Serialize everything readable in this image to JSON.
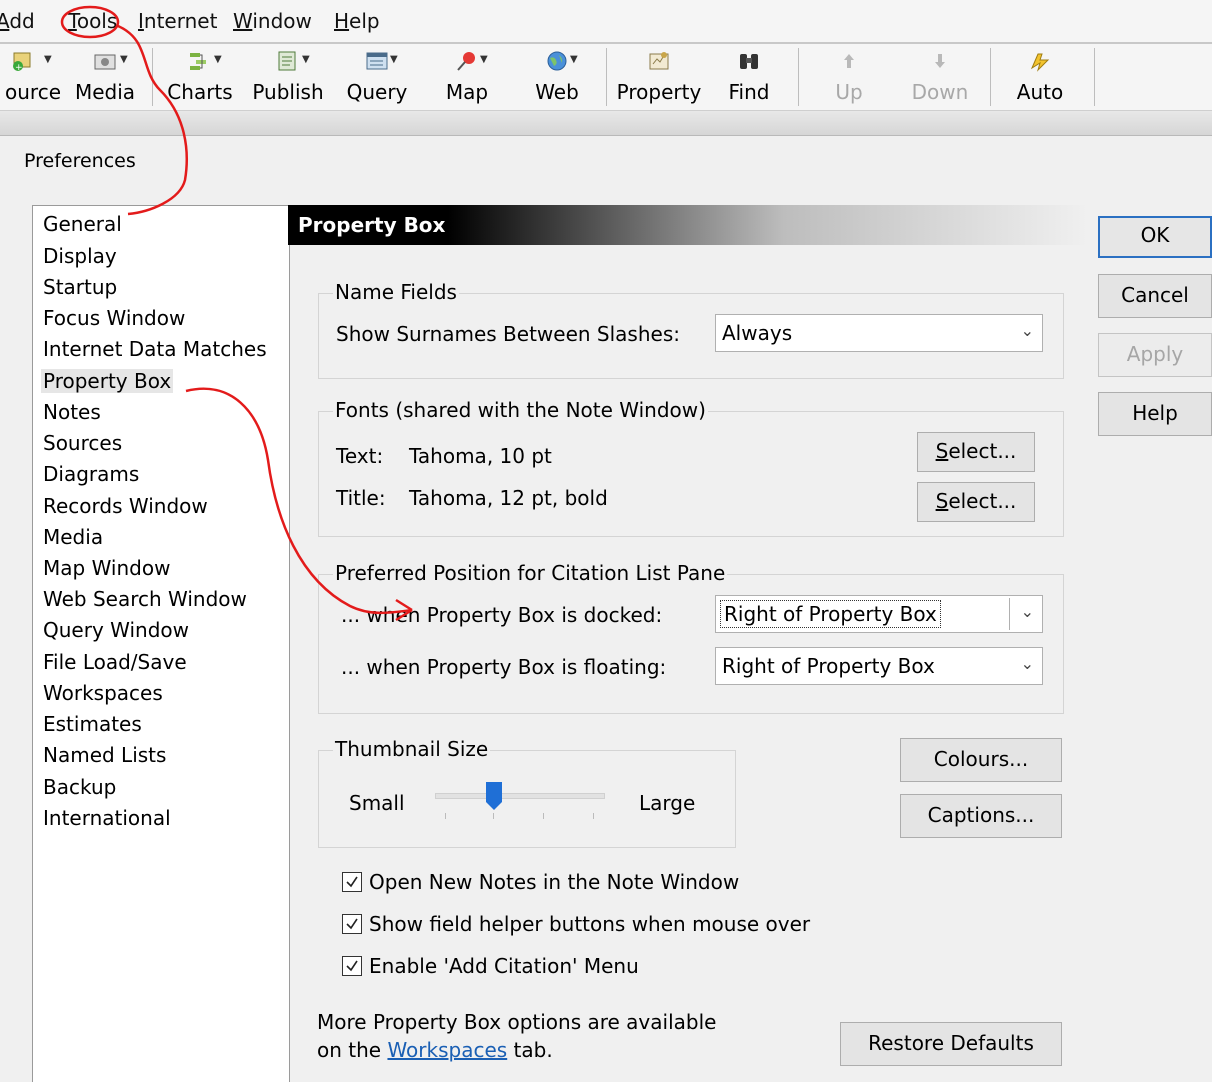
{
  "menubar": {
    "items": [
      {
        "label": "Add",
        "underline": "A",
        "rest": "dd"
      },
      {
        "label": "Tools",
        "underline": "T",
        "rest": "ools"
      },
      {
        "label": "Internet",
        "underline": "I",
        "rest": "nternet"
      },
      {
        "label": "Window",
        "underline": "W",
        "rest": "indow"
      },
      {
        "label": "Help",
        "underline": "H",
        "rest": "elp"
      }
    ]
  },
  "toolbar": {
    "buttons": [
      {
        "label": "ource",
        "icon": "source-icon"
      },
      {
        "label": "Media",
        "icon": "media-icon"
      },
      {
        "label": "Charts",
        "icon": "charts-icon"
      },
      {
        "label": "Publish",
        "icon": "publish-icon"
      },
      {
        "label": "Query",
        "icon": "query-icon"
      },
      {
        "label": "Map",
        "icon": "map-pin-icon"
      },
      {
        "label": "Web",
        "icon": "globe-icon"
      },
      {
        "label": "Property",
        "icon": "property-icon"
      },
      {
        "label": "Find",
        "icon": "binoculars-icon"
      },
      {
        "label": "Up",
        "icon": "up-arrow-icon",
        "disabled": true
      },
      {
        "label": "Down",
        "icon": "down-arrow-icon",
        "disabled": true
      },
      {
        "label": "Auto",
        "icon": "auto-icon"
      }
    ]
  },
  "dialog": {
    "title": "Preferences",
    "nav": {
      "items": [
        "General",
        "Display",
        "Startup",
        "Focus Window",
        "Internet Data Matches",
        "Property Box",
        "Notes",
        "Sources",
        "Diagrams",
        "Records Window",
        "Media",
        "Map Window",
        "Web Search Window",
        "Query Window",
        "File Load/Save",
        "Workspaces",
        "Estimates",
        "Named Lists",
        "Backup",
        "International"
      ],
      "selected": "Property Box"
    },
    "panel": {
      "header": "Property Box",
      "name_fields": {
        "legend": "Name Fields",
        "surnames_label": "Show Surnames Between Slashes:",
        "surnames_value": "Always"
      },
      "fonts": {
        "legend": "Fonts (shared with the Note Window)",
        "text_label": "Text:",
        "text_value": "Tahoma, 10 pt",
        "title_label": "Title:",
        "title_value": "Tahoma, 12 pt, bold",
        "select_label": "Select...",
        "select_underline": "S",
        "select_rest": "elect..."
      },
      "citation": {
        "legend": "Preferred Position for Citation List Pane",
        "docked_label": "... when Property Box is docked:",
        "docked_value": "Right of Property Box",
        "floating_label": "... when Property Box is floating:",
        "floating_value": "Right of Property Box"
      },
      "thumbnail": {
        "legend": "Thumbnail Size",
        "small_label": "Small",
        "large_label": "Large",
        "slider_position": 0.35
      },
      "colours_label": "Colours...",
      "captions_label": "Captions...",
      "checkboxes": [
        {
          "label": "Open New Notes in the Note Window",
          "checked": true
        },
        {
          "label": "Show field helper buttons when mouse over",
          "checked": true
        },
        {
          "label": "Enable 'Add Citation' Menu",
          "checked": true
        }
      ],
      "footer_text_1": "More Property Box options are available",
      "footer_text_2_pre": "on the ",
      "footer_link": "Workspaces",
      "footer_text_2_post": " tab.",
      "restore_label": "Restore Defaults"
    },
    "buttons": {
      "ok": "OK",
      "cancel": "Cancel",
      "apply": "Apply",
      "help": "Help"
    }
  },
  "colors": {
    "annotation_red": "#e31b1b",
    "link_blue": "#1a5fb4",
    "default_button_border": "#2b70c2",
    "slider_thumb": "#1f6fd6"
  }
}
